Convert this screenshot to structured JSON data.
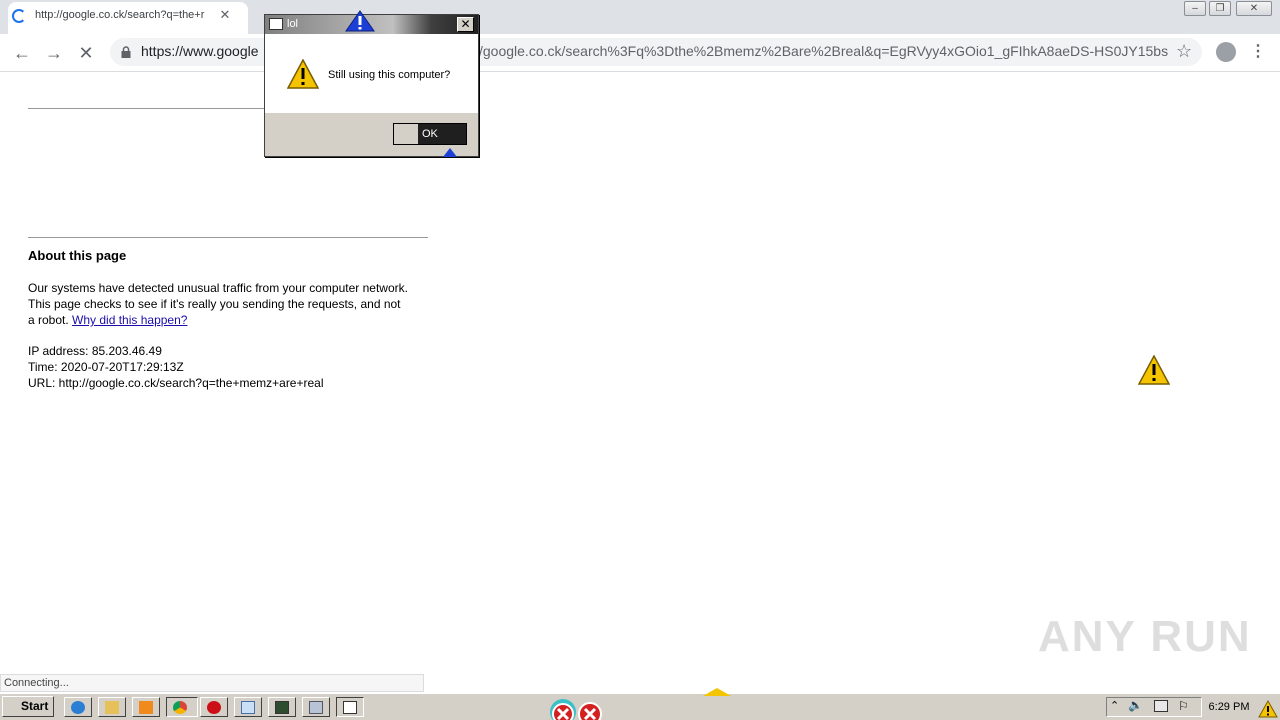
{
  "browser": {
    "tab_title": "http://google.co.ck/search?q=the+r",
    "tab_close": "✕",
    "url_left": "https://www.google",
    "url_right": "/google.co.ck/search%3Fq%3Dthe%2Bmemz%2Bare%2Breal&q=EgRVyy4xGOio1_gFIhkA8aeDS-HS0JY15bs..."
  },
  "page": {
    "about_title": "About this page",
    "message_text": "Our systems have detected unusual traffic from your computer network. This page checks to see if it's really you sending the requests, and not a robot. ",
    "why_link": "Why did this happen?",
    "ip_line": "IP address: 85.203.46.49",
    "time_line": "Time: 2020-07-20T17:29:13Z",
    "url_line": "URL: http://google.co.ck/search?q=the+memz+are+real"
  },
  "status": {
    "text": "Connecting..."
  },
  "watermark": {
    "text": "ANY RUN"
  },
  "dialog": {
    "title": "lol",
    "message": "Still using this computer?",
    "ok_label": "OK",
    "close_glyph": "✕"
  },
  "taskbar": {
    "start_label": "Start",
    "clock": "6:29 PM"
  },
  "colors": {
    "warning": "#f5c400",
    "chrome_blue": "#1a73e8",
    "link": "#1a0dab"
  }
}
